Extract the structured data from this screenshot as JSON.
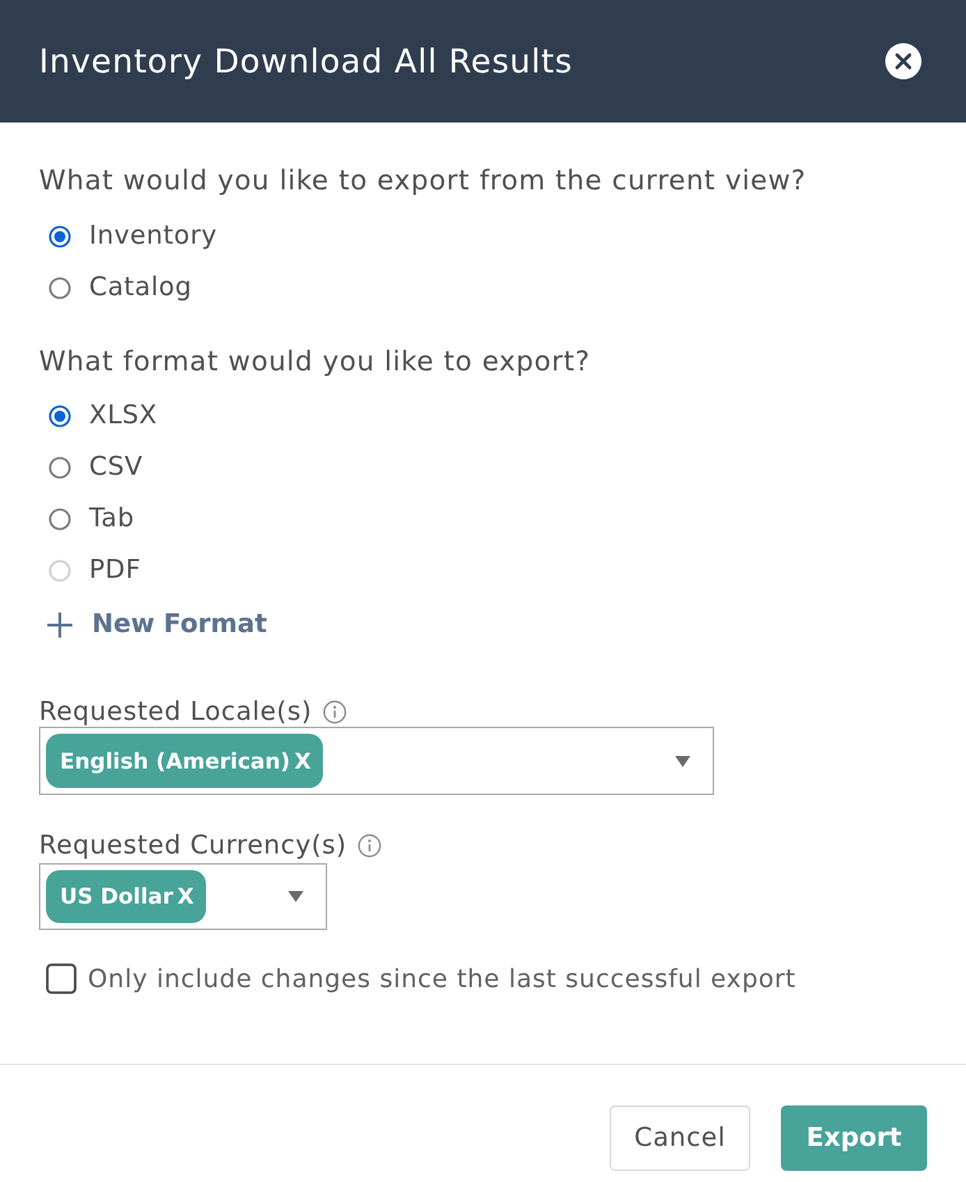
{
  "dialog": {
    "title": "Inventory Download All Results"
  },
  "export_question": {
    "label": "What would you like to export from the current view?",
    "options": [
      {
        "label": "Inventory",
        "selected": true,
        "disabled": false
      },
      {
        "label": "Catalog",
        "selected": false,
        "disabled": false
      }
    ]
  },
  "format_question": {
    "label": "What format would you like to export?",
    "options": [
      {
        "label": "XLSX",
        "selected": true,
        "disabled": false
      },
      {
        "label": "CSV",
        "selected": false,
        "disabled": false
      },
      {
        "label": "Tab",
        "selected": false,
        "disabled": false
      },
      {
        "label": "PDF",
        "selected": false,
        "disabled": true
      }
    ],
    "add_link": {
      "label": "New Format"
    }
  },
  "locale_field": {
    "label": "Requested Locale(s)",
    "chips": [
      {
        "label": "English (American)",
        "remove": "X"
      }
    ]
  },
  "currency_field": {
    "label": "Requested Currency(s)",
    "chips": [
      {
        "label": "US Dollar",
        "remove": "X"
      }
    ]
  },
  "changes_checkbox": {
    "label": "Only include changes since the last successful export",
    "checked": false
  },
  "buttons": [
    {
      "label": "Cancel",
      "kind": "secondary"
    },
    {
      "label": "Export",
      "kind": "primary"
    }
  ]
}
